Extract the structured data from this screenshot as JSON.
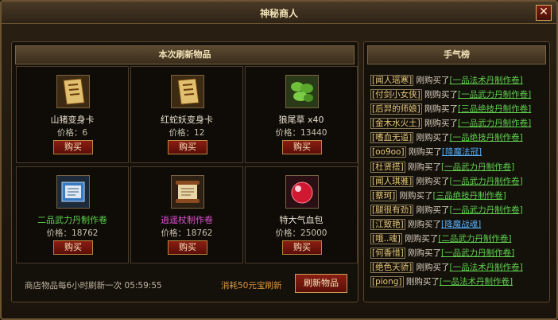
{
  "window": {
    "title": "神秘商人",
    "close_label": "✕"
  },
  "shop": {
    "header": "本次刷新物品",
    "items": [
      {
        "name": "山猪变身卡",
        "price": "价格：6",
        "name_color": "#e8e0cf",
        "icon": "card-scroll-icon",
        "buy_label": "购买"
      },
      {
        "name": "红蛇妖变身卡",
        "price": "价格：12",
        "name_color": "#e8e0cf",
        "icon": "card-scroll-icon",
        "buy_label": "购买"
      },
      {
        "name": "狼尾草 x40",
        "price": "价格：13440",
        "name_color": "#e8e0cf",
        "icon": "herb-leaf-icon",
        "buy_label": "购买"
      },
      {
        "name": "二品武力丹制作卷",
        "price": "价格：18762",
        "name_color": "#5fd14f",
        "icon": "blue-recipe-scroll-icon",
        "buy_label": "购买"
      },
      {
        "name": "逍遥杖制作卷",
        "price": "价格：18762",
        "name_color": "#e050d0",
        "icon": "rolled-scroll-icon",
        "buy_label": "购买"
      },
      {
        "name": "特大气血包",
        "price": "价格：25000",
        "name_color": "#e8e0cf",
        "icon": "red-orb-icon",
        "buy_label": "购买"
      }
    ],
    "refresh_note": "商店物品每6小时刷新一次",
    "countdown": "05:59:55",
    "cost_note": "消耗50元宝刷新",
    "refresh_button": "刷新物品"
  },
  "luck": {
    "header": "手气榜",
    "verb": "刚购买了",
    "entries": [
      {
        "player": "[闻人瑶寒]",
        "item": "[一品法术丹制作卷]",
        "color": "green"
      },
      {
        "player": "[付剑小女侠]",
        "item": "[一品武力丹制作卷]",
        "color": "green"
      },
      {
        "player": "[后羿的师娘]",
        "item": "[三品绝技丹制作卷]",
        "color": "green"
      },
      {
        "player": "[金木水火土]",
        "item": "[一品武力丹制作卷]",
        "color": "green"
      },
      {
        "player": "[嗜血无道]",
        "item": "[一品绝技丹制作卷]",
        "color": "green"
      },
      {
        "player": "[oo9oo]",
        "item": "[降魔法冠]",
        "color": "blue"
      },
      {
        "player": "[杜贤搭]",
        "item": "[一品武力丹制作卷]",
        "color": "green"
      },
      {
        "player": "[闻人琪雅]",
        "item": "[一品武力丹制作卷]",
        "color": "green"
      },
      {
        "player": "[蔡珂]",
        "item": "[三品绝技丹制作卷]",
        "color": "green"
      },
      {
        "player": "[腿很有劲]",
        "item": "[一品武力丹制作卷]",
        "color": "green"
      },
      {
        "player": "[江致艳]",
        "item": "[降魔战魂]",
        "color": "blue"
      },
      {
        "player": "[哦..魂]",
        "item": "[二品武力丹制作卷]",
        "color": "green"
      },
      {
        "player": "[何香惜]",
        "item": "[一品武力丹制作卷]",
        "color": "green"
      },
      {
        "player": "[绝色天骄]",
        "item": "[一品法术丹制作卷]",
        "color": "green"
      },
      {
        "player": "[piong]",
        "item": "[一品法术丹制作卷]",
        "color": "green"
      }
    ]
  }
}
